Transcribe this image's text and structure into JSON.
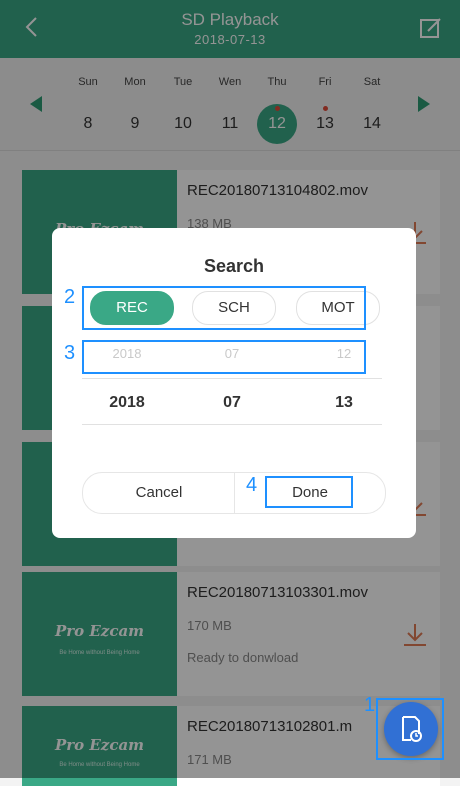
{
  "header": {
    "title": "SD Playback",
    "date": "2018-07-13"
  },
  "calendar": {
    "days": [
      {
        "name": "Sun",
        "num": "8",
        "selected": false,
        "has_record": false
      },
      {
        "name": "Mon",
        "num": "9",
        "selected": false,
        "has_record": false
      },
      {
        "name": "Tue",
        "num": "10",
        "selected": false,
        "has_record": false
      },
      {
        "name": "Wen",
        "num": "11",
        "selected": false,
        "has_record": false
      },
      {
        "name": "Thu",
        "num": "12",
        "selected": true,
        "has_record": true
      },
      {
        "name": "Fri",
        "num": "13",
        "selected": false,
        "has_record": true
      },
      {
        "name": "Sat",
        "num": "14",
        "selected": false,
        "has_record": false
      }
    ]
  },
  "thumbnail": {
    "logo": "Pro Ezcam",
    "slogan": "Be Home without Being Home"
  },
  "recordings": [
    {
      "file": "REC20180713104802.mov",
      "size": "138 MB",
      "status": ""
    },
    {
      "file": "",
      "size": "",
      "status": ""
    },
    {
      "file": "",
      "size": "",
      "status": ""
    },
    {
      "file": "REC20180713103301.mov",
      "size": "170 MB",
      "status": "Ready to donwload"
    },
    {
      "file": "REC20180713102801.m",
      "size": "171 MB",
      "status": ""
    }
  ],
  "dialog": {
    "title": "Search",
    "types": [
      "REC",
      "SCH",
      "MOT"
    ],
    "active_type": "REC",
    "picker_prev": {
      "year": "2018",
      "month": "07",
      "day": "12"
    },
    "picker_current": {
      "year": "2018",
      "month": "07",
      "day": "13"
    },
    "cancel_label": "Cancel",
    "done_label": "Done"
  },
  "callouts": [
    "1",
    "2",
    "3",
    "4"
  ],
  "colors": {
    "accent": "#3aa886",
    "highlight": "#1e90ff",
    "fab": "#3170d4",
    "record_dot": "#e04b3a"
  },
  "icons": {
    "back": "chevron-left-icon",
    "edit": "edit-icon",
    "download": "download-icon",
    "fab": "search-file-icon"
  }
}
